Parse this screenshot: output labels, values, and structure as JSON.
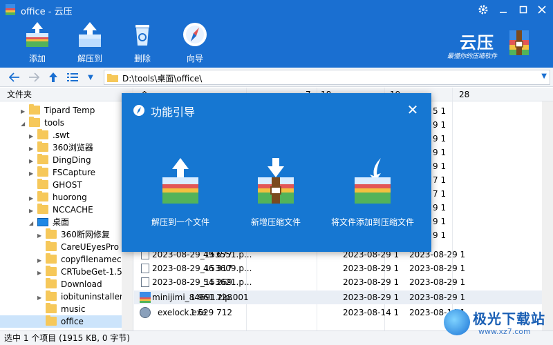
{
  "window": {
    "title": "office - 云压"
  },
  "toolbar": {
    "add_label": "添加",
    "extract_label": "解压到",
    "delete_label": "删除",
    "wizard_label": "向导"
  },
  "brand": {
    "name": "云压",
    "slogan": "最懂你的压缩软件"
  },
  "addressbar": {
    "path": "D:\\tools\\桌面\\office\\"
  },
  "tree": {
    "header": "文件夹",
    "items": [
      {
        "label": "Tipard Temp"
      },
      {
        "label": "tools"
      },
      {
        "label": ".swt"
      },
      {
        "label": "360浏览器"
      },
      {
        "label": "DingDing"
      },
      {
        "label": "FSCapture"
      },
      {
        "label": "GHOST"
      },
      {
        "label": "huorong"
      },
      {
        "label": "NCCACHE"
      },
      {
        "label": "桌面"
      },
      {
        "label": "360断网修复"
      },
      {
        "label": "CareUEyesPro"
      },
      {
        "label": "copyfilenamecr"
      },
      {
        "label": "CRTubeGet-1.5"
      },
      {
        "label": "Download"
      },
      {
        "label": "iobituninstaller"
      },
      {
        "label": "music"
      },
      {
        "label": "office"
      }
    ]
  },
  "list": {
    "header": {
      "col_a": "^",
      "col_b": "7",
      "col_c": "18",
      "col_d": "19",
      "col_e": "28"
    },
    "rows": [
      {
        "name": "2023-08-29_153551.p...",
        "size": "49 677",
        "modified": "2023-08-29 1",
        "created": "2023-08-29 1"
      },
      {
        "name": "2023-08-29_153609.p...",
        "size": "46 317",
        "modified": "2023-08-29 1",
        "created": "2023-08-29 1"
      },
      {
        "name": "2023-08-29_153621.p...",
        "size": "54 269",
        "modified": "2023-08-29 1",
        "created": "2023-08-29 1"
      },
      {
        "name": "minijimi_84691.zip.001",
        "size": "1 961 728",
        "modified": "2023-08-29 1",
        "created": "2023-08-29 1"
      },
      {
        "name": "exelock.exe",
        "size": "1 529 712",
        "modified": "2023-08-14 1",
        "created": "2023-08-14 1"
      }
    ],
    "peek_dates": [
      "5 1",
      "9 1",
      "9 1",
      "9 1",
      "9 1",
      "7 1",
      "7 1",
      "9 1",
      "9 1",
      "9 1"
    ]
  },
  "status": {
    "text": "选中 1 个项目 (1915 KB, 0 字节)"
  },
  "watermark": {
    "brand": "极光下载站",
    "url": "www.xz7.com"
  },
  "dialog": {
    "title": "功能引导",
    "options": [
      {
        "label": "解压到一个文件"
      },
      {
        "label": "新增压缩文件"
      },
      {
        "label": "将文件添加到压缩文件"
      }
    ]
  },
  "colors": {
    "accent": "#1a6fd1",
    "dialog_bg": "#1677d2",
    "selection": "#cce4fb"
  }
}
